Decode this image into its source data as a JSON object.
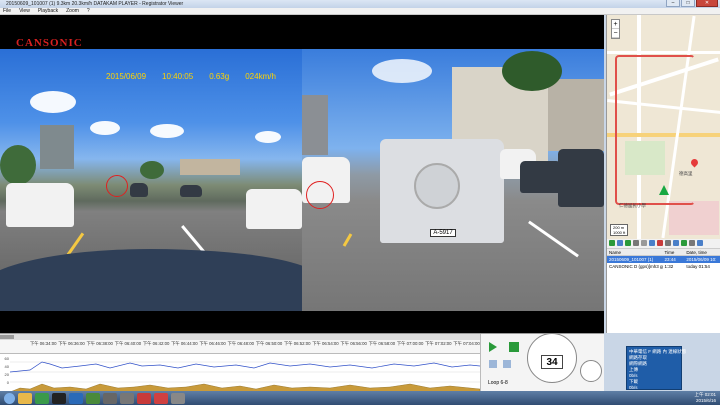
{
  "window": {
    "title": "20150609_101007 (1)    9.3km    20.3km/h    DATAKAM PLAYER - Registrator Viewer",
    "controls": [
      "–",
      "□",
      "✕"
    ]
  },
  "menu": [
    "File",
    "View",
    "Playback",
    "Zoom",
    "?"
  ],
  "video": {
    "brand": "CANSONIC",
    "date": "2015/06/09",
    "time": "10:40:05",
    "gforce": "0.63g",
    "speed": "024km/h",
    "plate": "A-5917"
  },
  "map": {
    "zoom_in": "+",
    "zoom_out": "−",
    "labels": [
      "德高里",
      "仁德國民小學"
    ],
    "scale_m": "200 m",
    "scale_ft": "1000 ft"
  },
  "list": {
    "columns": [
      "Name",
      "Time",
      "Date, time"
    ],
    "rows": [
      {
        "name": "20150609_101007 (1)",
        "time": "23:44",
        "date": "2015/06/09 10:",
        "selected": true
      },
      {
        "name": "CANSONIC D (gps)[mh3 gps]",
        "time": "1:32",
        "date": "today 01:54",
        "selected": false
      }
    ]
  },
  "timeline": {
    "ticks": [
      "下午 06:34:00",
      "下午 06:36:00",
      "下午 06:38:00",
      "下午 06:40:00",
      "下午 06:42:00",
      "下午 06:44:00",
      "下午 06:46:00",
      "下午 06:48:00",
      "下午 06:50:00",
      "下午 06:52:00",
      "下午 06:54:00",
      "下午 06:56:00",
      "下午 06:58:00",
      "下午 07:00:00",
      "下午 07:02:00",
      "下午 07:04:00"
    ],
    "ylabels": [
      "60",
      "40",
      "20",
      "0"
    ],
    "peaks": [
      "48",
      "52",
      "56",
      "54",
      "47",
      "35",
      "42",
      "38",
      "12",
      "44",
      "2.84",
      "4.06",
      "2.52",
      "4.34",
      "2.84",
      "4.42"
    ],
    "loop_label": "Loop 6-8",
    "speed_display": "34"
  },
  "popup": {
    "title": "中華電信 F 網路 內 連線狀態",
    "lines": [
      "網路存取",
      "網際網路",
      "上傳",
      "0b/s",
      "下載",
      "0b/s"
    ]
  },
  "clock": {
    "time": "上午 02:01",
    "date": "2015/6/16"
  },
  "colors": {
    "accent": "#3a78d8",
    "route": "#e0504a",
    "overlay": "#ffd400"
  }
}
